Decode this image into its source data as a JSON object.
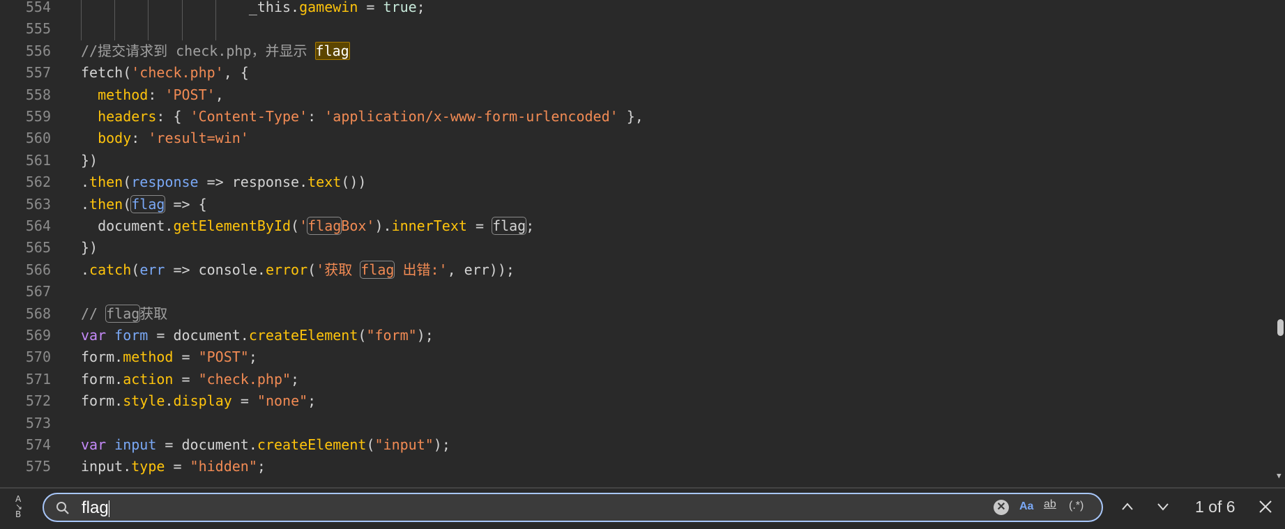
{
  "colors": {
    "background": "#292929",
    "accent": "#a8c7fa",
    "match_current": "#5c4500"
  },
  "editor": {
    "lines": [
      {
        "n": "554",
        "guides": 5,
        "indent": "                    ",
        "tokens": [
          {
            "t": "_this.",
            "c": "p"
          },
          {
            "t": "gamewin",
            "c": "k"
          },
          {
            "t": " = ",
            "c": "p"
          },
          {
            "t": "true",
            "c": "b"
          },
          {
            "t": ";",
            "c": "p"
          }
        ]
      },
      {
        "n": "555",
        "guides": 5,
        "tokens": []
      },
      {
        "n": "556",
        "tokens": [
          {
            "t": "//提交请求到 check.php，并显示 ",
            "c": "c"
          },
          {
            "t": "flag",
            "c": "c",
            "m": "cur"
          }
        ]
      },
      {
        "n": "557",
        "tokens": [
          {
            "t": "fetch(",
            "c": "p"
          },
          {
            "t": "'check.php'",
            "c": "s"
          },
          {
            "t": ", {",
            "c": "p"
          }
        ]
      },
      {
        "n": "558",
        "tokens": [
          {
            "t": "  ",
            "c": "p"
          },
          {
            "t": "method",
            "c": "k"
          },
          {
            "t": ": ",
            "c": "p"
          },
          {
            "t": "'POST'",
            "c": "s"
          },
          {
            "t": ",",
            "c": "p"
          }
        ]
      },
      {
        "n": "559",
        "tokens": [
          {
            "t": "  ",
            "c": "p"
          },
          {
            "t": "headers",
            "c": "k"
          },
          {
            "t": ": { ",
            "c": "p"
          },
          {
            "t": "'Content-Type'",
            "c": "s"
          },
          {
            "t": ": ",
            "c": "p"
          },
          {
            "t": "'application/x-www-form-urlencoded'",
            "c": "s"
          },
          {
            "t": " },",
            "c": "p"
          }
        ]
      },
      {
        "n": "560",
        "tokens": [
          {
            "t": "  ",
            "c": "p"
          },
          {
            "t": "body",
            "c": "k"
          },
          {
            "t": ": ",
            "c": "p"
          },
          {
            "t": "'result=win'",
            "c": "s"
          }
        ]
      },
      {
        "n": "561",
        "tokens": [
          {
            "t": "})",
            "c": "p"
          }
        ]
      },
      {
        "n": "562",
        "tokens": [
          {
            "t": ".",
            "c": "p"
          },
          {
            "t": "then",
            "c": "k"
          },
          {
            "t": "(",
            "c": "p"
          },
          {
            "t": "response",
            "c": "v"
          },
          {
            "t": " => response.",
            "c": "p"
          },
          {
            "t": "text",
            "c": "k"
          },
          {
            "t": "())",
            "c": "p"
          }
        ]
      },
      {
        "n": "563",
        "tokens": [
          {
            "t": ".",
            "c": "p"
          },
          {
            "t": "then",
            "c": "k"
          },
          {
            "t": "(",
            "c": "p"
          },
          {
            "t": "flag",
            "c": "v",
            "m": "m"
          },
          {
            "t": " => {",
            "c": "p"
          }
        ]
      },
      {
        "n": "564",
        "tokens": [
          {
            "t": "  document.",
            "c": "p"
          },
          {
            "t": "getElementById",
            "c": "k"
          },
          {
            "t": "(",
            "c": "p"
          },
          {
            "t": "'",
            "c": "s"
          },
          {
            "t": "flag",
            "c": "s",
            "m": "m"
          },
          {
            "t": "Box'",
            "c": "s"
          },
          {
            "t": ").",
            "c": "p"
          },
          {
            "t": "innerText",
            "c": "k"
          },
          {
            "t": " = ",
            "c": "p"
          },
          {
            "t": "flag",
            "c": "p",
            "m": "m"
          },
          {
            "t": ";",
            "c": "p"
          }
        ]
      },
      {
        "n": "565",
        "tokens": [
          {
            "t": "})",
            "c": "p"
          }
        ]
      },
      {
        "n": "566",
        "tokens": [
          {
            "t": ".",
            "c": "p"
          },
          {
            "t": "catch",
            "c": "k"
          },
          {
            "t": "(",
            "c": "p"
          },
          {
            "t": "err",
            "c": "v"
          },
          {
            "t": " => console.",
            "c": "p"
          },
          {
            "t": "error",
            "c": "k"
          },
          {
            "t": "(",
            "c": "p"
          },
          {
            "t": "'获取 ",
            "c": "s"
          },
          {
            "t": "flag",
            "c": "s",
            "m": "m"
          },
          {
            "t": " 出错:'",
            "c": "s"
          },
          {
            "t": ", err));",
            "c": "p"
          }
        ]
      },
      {
        "n": "567",
        "tokens": []
      },
      {
        "n": "568",
        "tokens": [
          {
            "t": "// ",
            "c": "c"
          },
          {
            "t": "flag",
            "c": "c",
            "m": "m"
          },
          {
            "t": "获取",
            "c": "c"
          }
        ]
      },
      {
        "n": "569",
        "tokens": [
          {
            "t": "var",
            "c": "kw"
          },
          {
            "t": " ",
            "c": "p"
          },
          {
            "t": "form",
            "c": "v"
          },
          {
            "t": " = document.",
            "c": "p"
          },
          {
            "t": "createElement",
            "c": "k"
          },
          {
            "t": "(",
            "c": "p"
          },
          {
            "t": "\"form\"",
            "c": "s"
          },
          {
            "t": ");",
            "c": "p"
          }
        ]
      },
      {
        "n": "570",
        "tokens": [
          {
            "t": "form.",
            "c": "p"
          },
          {
            "t": "method",
            "c": "k"
          },
          {
            "t": " = ",
            "c": "p"
          },
          {
            "t": "\"POST\"",
            "c": "s"
          },
          {
            "t": ";",
            "c": "p"
          }
        ]
      },
      {
        "n": "571",
        "tokens": [
          {
            "t": "form.",
            "c": "p"
          },
          {
            "t": "action",
            "c": "k"
          },
          {
            "t": " = ",
            "c": "p"
          },
          {
            "t": "\"check.php\"",
            "c": "s"
          },
          {
            "t": ";",
            "c": "p"
          }
        ]
      },
      {
        "n": "572",
        "tokens": [
          {
            "t": "form.",
            "c": "p"
          },
          {
            "t": "style",
            "c": "k"
          },
          {
            "t": ".",
            "c": "p"
          },
          {
            "t": "display",
            "c": "k"
          },
          {
            "t": " = ",
            "c": "p"
          },
          {
            "t": "\"none\"",
            "c": "s"
          },
          {
            "t": ";",
            "c": "p"
          }
        ]
      },
      {
        "n": "573",
        "tokens": []
      },
      {
        "n": "574",
        "tokens": [
          {
            "t": "var",
            "c": "kw"
          },
          {
            "t": " ",
            "c": "p"
          },
          {
            "t": "input",
            "c": "v"
          },
          {
            "t": " = document.",
            "c": "p"
          },
          {
            "t": "createElement",
            "c": "k"
          },
          {
            "t": "(",
            "c": "p"
          },
          {
            "t": "\"input\"",
            "c": "s"
          },
          {
            "t": ");",
            "c": "p"
          }
        ]
      },
      {
        "n": "575",
        "tokens": [
          {
            "t": "input.",
            "c": "p"
          },
          {
            "t": "type",
            "c": "k"
          },
          {
            "t": " = ",
            "c": "p"
          },
          {
            "t": "\"hidden\"",
            "c": "s"
          },
          {
            "t": ";",
            "c": "p"
          }
        ]
      }
    ]
  },
  "find": {
    "query": "flag",
    "match_count": "1 of 6",
    "replace_toggle": "A↘B",
    "match_case": "Aa",
    "whole_word": "ab",
    "regex": "(.*)",
    "icons": {
      "search": "search-icon",
      "clear": "clear-icon",
      "prev": "chevron-up-icon",
      "next": "chevron-down-icon",
      "close": "close-icon"
    }
  }
}
